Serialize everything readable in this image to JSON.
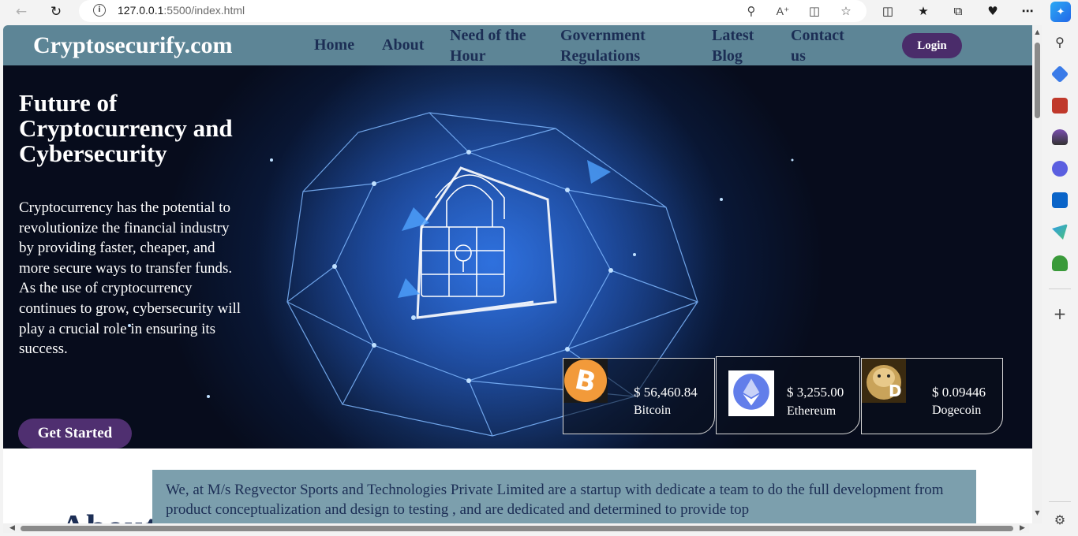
{
  "browser": {
    "url_host": "127.0.0.1",
    "url_rest": ":5500/index.html"
  },
  "site": {
    "brand": "Cryptosecurify.com",
    "nav": [
      {
        "line1": "Home",
        "line2": ""
      },
      {
        "line1": "About",
        "line2": ""
      },
      {
        "line1": "Need of the",
        "line2": "Hour"
      },
      {
        "line1": "Government",
        "line2": "Regulations"
      },
      {
        "line1": "Latest",
        "line2": "Blog"
      },
      {
        "line1": "Contact",
        "line2": "us"
      }
    ],
    "login_label": "Login"
  },
  "hero": {
    "title": "Future of Cryptocurrency and Cybersecurity",
    "text": "Cryptocurrency has the potential to revolutionize the financial industry by providing faster, cheaper, and more secure ways to transfer funds. As the use of cryptocurrency continues to grow, cybersecurity will play a crucial role in ensuring its success.",
    "cta_label": "Get Started"
  },
  "coins": [
    {
      "price": "$ 56,460.84",
      "name": "Bitcoin",
      "icon": "bitcoin-logo",
      "color": "#f29a3a"
    },
    {
      "price": "$ 3,255.00",
      "name": "Ethereum",
      "icon": "ethereum-logo",
      "color": "#627eea"
    },
    {
      "price": "$ 0.09446",
      "name": "Dogecoin",
      "icon": "dogecoin-logo",
      "color": "#c9a35a"
    }
  ],
  "about": {
    "text": "We, at M/s Regvector Sports and Technologies Private Limited are a startup with dedicate a team to do the full development from product conceptualization and design to testing , and are dedicated and determined to provide top",
    "heading": "About"
  },
  "colors": {
    "header_bg": "#5d8596",
    "nav_text": "#1c2e55",
    "button_purple": "#4a2c6a",
    "about_box": "#7c9fad"
  }
}
